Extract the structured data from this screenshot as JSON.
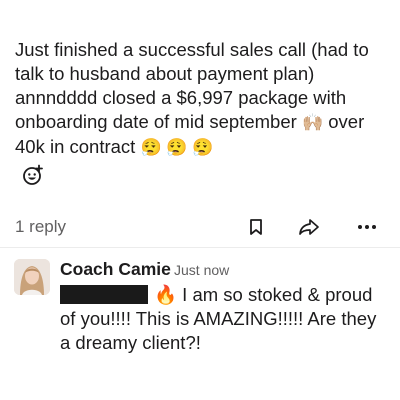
{
  "message": {
    "line1": "Just finished a successful sales call (had to",
    "line2": "talk to husband about payment plan)",
    "line3": "annndddd closed a $6,997 package with",
    "line4_text": "onboarding date of mid september",
    "line4_emoji": "🙌🏼",
    "line4_end": " over",
    "line5_text": "40k in contract",
    "line5_emoji": "😮‍💨 😮‍💨 😮‍💨"
  },
  "actions": {
    "reply_count": "1 reply",
    "more_label": "•••"
  },
  "reply": {
    "author": "Coach Camie",
    "timestamp": "Just now",
    "emoji": "🔥",
    "line1": " I am so stoked & proud",
    "line2": "of you!!!! This is AMAZING!!!!! Are they",
    "line3": "a dreamy client?!"
  },
  "icons": {
    "add_reaction": "add-reaction-icon",
    "bookmark": "bookmark-icon",
    "share": "share-arrow-icon",
    "more": "more-horizontal-icon"
  },
  "colors": {
    "text": "#1d1c1d",
    "muted": "#616061",
    "redaction": "#1a1a1a"
  }
}
